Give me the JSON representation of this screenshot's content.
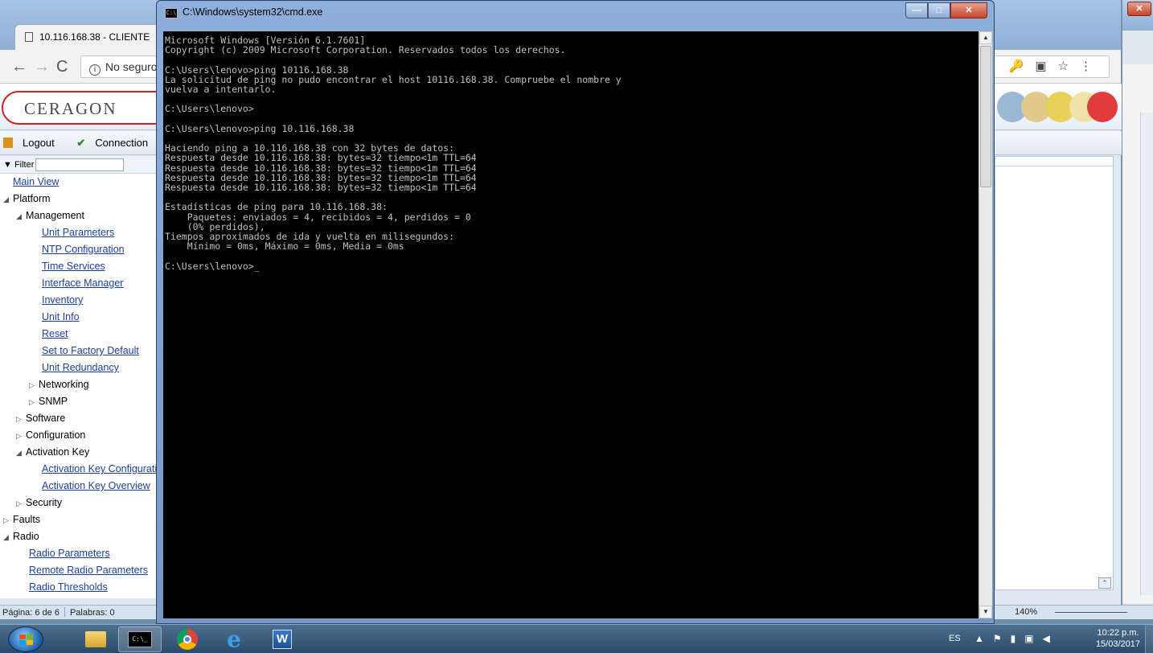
{
  "browser": {
    "tab_title": "10.116.168.38 - CLIENTE",
    "address_text": "No seguro",
    "logo_text": "CERAGON",
    "menu": {
      "logout": "Logout",
      "connection": "Connection"
    },
    "filter_label": "▼ Filter",
    "tree": [
      {
        "label": "Main View",
        "indent": 0,
        "link": true,
        "arrow": ""
      },
      {
        "label": "Platform",
        "indent": 0,
        "link": false,
        "arrow": "◢"
      },
      {
        "label": "Management",
        "indent": 1,
        "link": false,
        "arrow": "◢"
      },
      {
        "label": "Unit Parameters",
        "indent": 2,
        "link": true,
        "arrow": ""
      },
      {
        "label": "NTP Configuration",
        "indent": 2,
        "link": true,
        "arrow": ""
      },
      {
        "label": "Time Services",
        "indent": 2,
        "link": true,
        "arrow": ""
      },
      {
        "label": "Interface Manager",
        "indent": 2,
        "link": true,
        "arrow": ""
      },
      {
        "label": "Inventory",
        "indent": 2,
        "link": true,
        "arrow": ""
      },
      {
        "label": "Unit Info",
        "indent": 2,
        "link": true,
        "arrow": ""
      },
      {
        "label": "Reset",
        "indent": 2,
        "link": true,
        "arrow": ""
      },
      {
        "label": "Set to Factory Default",
        "indent": 2,
        "link": true,
        "arrow": ""
      },
      {
        "label": "Unit Redundancy",
        "indent": 2,
        "link": true,
        "arrow": ""
      },
      {
        "label": "Networking",
        "indent": 2,
        "link": false,
        "arrow": "▷"
      },
      {
        "label": "SNMP",
        "indent": 2,
        "link": false,
        "arrow": "▷"
      },
      {
        "label": "Software",
        "indent": 1,
        "link": false,
        "arrow": "▷"
      },
      {
        "label": "Configuration",
        "indent": 1,
        "link": false,
        "arrow": "▷"
      },
      {
        "label": "Activation Key",
        "indent": 1,
        "link": false,
        "arrow": "◢"
      },
      {
        "label": "Activation Key Configuration",
        "indent": 2,
        "link": true,
        "arrow": ""
      },
      {
        "label": "Activation Key Overview",
        "indent": 2,
        "link": true,
        "arrow": ""
      },
      {
        "label": "Security",
        "indent": 1,
        "link": false,
        "arrow": "▷"
      },
      {
        "label": "Faults",
        "indent": 0,
        "link": false,
        "arrow": "▷"
      },
      {
        "label": "Radio",
        "indent": 0,
        "link": false,
        "arrow": "◢"
      },
      {
        "label": "Radio Parameters",
        "indent": 1,
        "link": true,
        "arrow": ""
      },
      {
        "label": "Remote Radio Parameters",
        "indent": 1,
        "link": true,
        "arrow": ""
      },
      {
        "label": "Radio Thresholds",
        "indent": 1,
        "link": true,
        "arrow": ""
      }
    ],
    "header_dot_colors": [
      "#9ab7d6",
      "#e0c98a",
      "#e8d05a",
      "#f1e3a8",
      "#e23b3b"
    ]
  },
  "cmd": {
    "title": "C:\\Windows\\system32\\cmd.exe",
    "output": "Microsoft Windows [Versión 6.1.7601]\nCopyright (c) 2009 Microsoft Corporation. Reservados todos los derechos.\n\nC:\\Users\\lenovo>ping 10116.168.38\nLa solicitud de ping no pudo encontrar el host 10116.168.38. Compruebe el nombre y\nvuelva a intentarlo.\n\nC:\\Users\\lenovo>\n\nC:\\Users\\lenovo>ping 10.116.168.38\n\nHaciendo ping a 10.116.168.38 con 32 bytes de datos:\nRespuesta desde 10.116.168.38: bytes=32 tiempo<1m TTL=64\nRespuesta desde 10.116.168.38: bytes=32 tiempo<1m TTL=64\nRespuesta desde 10.116.168.38: bytes=32 tiempo<1m TTL=64\nRespuesta desde 10.116.168.38: bytes=32 tiempo<1m TTL=64\n\nEstadísticas de ping para 10.116.168.38:\n    Paquetes: enviados = 4, recibidos = 4, perdidos = 0\n    (0% perdidos),\nTiempos aproximados de ida y vuelta en milisegundos:\n    Mínimo = 0ms, Máximo = 0ms, Media = 0ms\n\nC:\\Users\\lenovo>_",
    "buttons": {
      "minimize": "—",
      "maximize": "□",
      "close": "✕"
    }
  },
  "word_status": {
    "page": "Página: 6 de 6",
    "words": "Palabras: 0",
    "zoom": "140%"
  },
  "taskbar": {
    "lang": "ES",
    "time": "10:22 p.m.",
    "date": "15/03/2017",
    "cmd_label": "C:\\_"
  }
}
